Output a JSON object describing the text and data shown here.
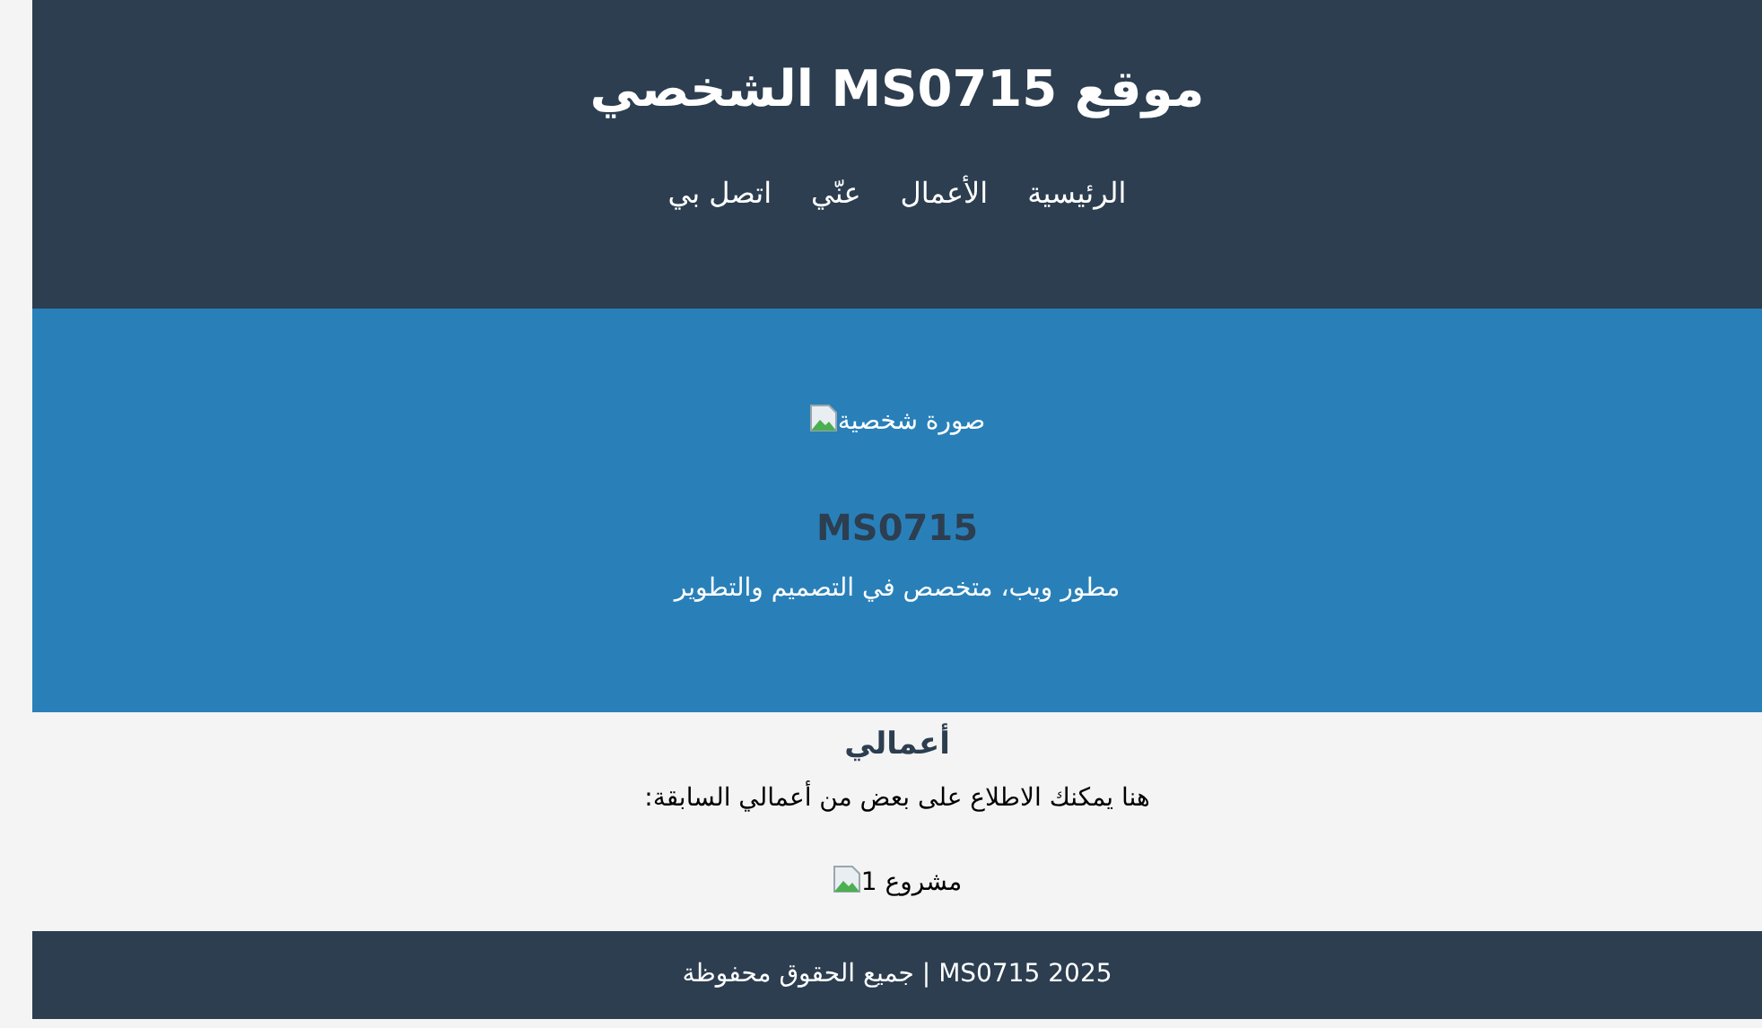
{
  "header": {
    "title": "موقع MS0715 الشخصي",
    "nav": [
      {
        "label": "الرئيسية"
      },
      {
        "label": "الأعمال"
      },
      {
        "label": "عنّي"
      },
      {
        "label": "اتصل بي"
      }
    ]
  },
  "hero": {
    "image_alt": "صورة شخصية",
    "name": "MS0715",
    "tagline": "مطور ويب، متخصص في التصميم والتطوير"
  },
  "works": {
    "heading": "أعمالي",
    "intro": "هنا يمكنك الاطلاع على بعض من أعمالي السابقة:",
    "projects": [
      {
        "image_alt": "مشروع 1"
      }
    ]
  },
  "footer": {
    "text": "2025 MS0715 | جميع الحقوق محفوظة"
  }
}
